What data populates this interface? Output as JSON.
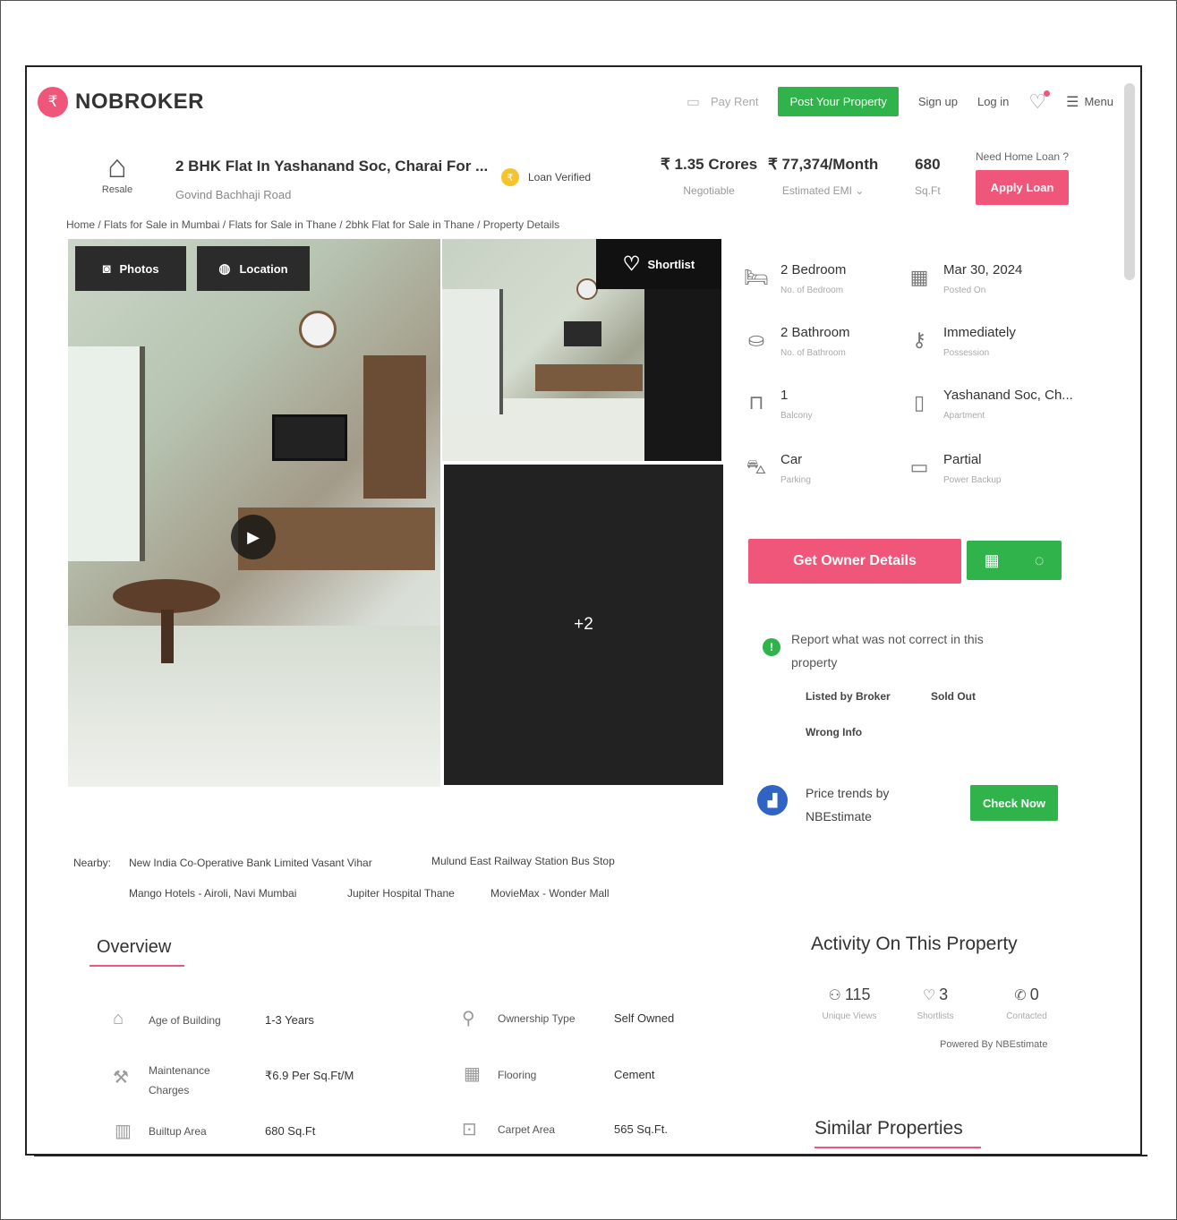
{
  "header": {
    "logo_text": "NOBROKER",
    "nav": {
      "pay_rent": "Pay Rent",
      "post_property": "Post Your Property",
      "sign_up": "Sign up",
      "log_in": "Log in",
      "menu": "Menu"
    }
  },
  "listing": {
    "badge": "Resale",
    "title": "2 BHK Flat In Yashanand Soc, Charai For ...",
    "subtitle": "Govind Bachhaji Road",
    "loan_verified": "Loan Verified",
    "price": "₹ 1.35 Crores",
    "price_note": "Negotiable",
    "emi": "₹ 77,374/Month",
    "emi_note": "Estimated EMI ⌄",
    "area": "680",
    "area_unit": "Sq.Ft",
    "home_loan_q": "Need Home Loan ?",
    "apply_loan": "Apply Loan"
  },
  "breadcrumb": "Home / Flats for Sale in Mumbai / Flats for Sale in Thane / 2bhk Flat for Sale in Thane / Property Details",
  "gallery": {
    "photos_tab": "Photos",
    "location_tab": "Location",
    "shortlist": "Shortlist",
    "more_count": "+2"
  },
  "specs": [
    {
      "value": "2 Bedroom",
      "label": "No. of Bedroom",
      "icon": "bed-icon"
    },
    {
      "value": "Mar 30, 2024",
      "label": "Posted On",
      "icon": "calendar-icon"
    },
    {
      "value": "2 Bathroom",
      "label": "No. of Bathroom",
      "icon": "bathtub-icon"
    },
    {
      "value": "Immediately",
      "label": "Possession",
      "icon": "key-icon"
    },
    {
      "value": "1",
      "label": "Balcony",
      "icon": "balcony-icon"
    },
    {
      "value": "Yashanand Soc, Ch...",
      "label": "Apartment",
      "icon": "building-icon"
    },
    {
      "value": "Car",
      "label": "Parking",
      "icon": "car-icon"
    },
    {
      "value": "Partial",
      "label": "Power Backup",
      "icon": "battery-icon"
    }
  ],
  "actions": {
    "owner_details": "Get Owner Details"
  },
  "report": {
    "text": "Report what was not correct in this property",
    "opt_broker": "Listed by Broker",
    "opt_sold": "Sold Out",
    "opt_wrong": "Wrong Info"
  },
  "trends": {
    "text": "Price trends by NBEstimate",
    "button": "Check Now"
  },
  "nearby": {
    "label": "Nearby:",
    "places": [
      "New India Co-Operative Bank Limited Vasant Vihar",
      "Mulund East Railway Station Bus Stop",
      "Mango Hotels - Airoli, Navi Mumbai",
      "Jupiter Hospital Thane",
      "MovieMax - Wonder Mall"
    ]
  },
  "overview": {
    "title": "Overview",
    "items": [
      {
        "label": "Age of Building",
        "value": "1-3 Years"
      },
      {
        "label": "Ownership Type",
        "value": "Self Owned"
      },
      {
        "label": "Maintenance Charges",
        "value": "₹6.9 Per Sq.Ft/M"
      },
      {
        "label": "Flooring",
        "value": "Cement"
      },
      {
        "label": "Builtup Area",
        "value": "680 Sq.Ft"
      },
      {
        "label": "Carpet Area",
        "value": "565 Sq.Ft."
      }
    ]
  },
  "activity": {
    "title": "Activity On This Property",
    "views": "115",
    "views_label": "Unique Views",
    "shortlists": "3",
    "shortlists_label": "Shortlists",
    "contacted": "0",
    "contacted_label": "Contacted",
    "powered_by": "Powered By   NBEstimate"
  },
  "similar": {
    "title": "Similar Properties"
  },
  "colors": {
    "brand_pink": "#f0567a",
    "green": "#2fb34a",
    "blue": "#2f64c4"
  }
}
